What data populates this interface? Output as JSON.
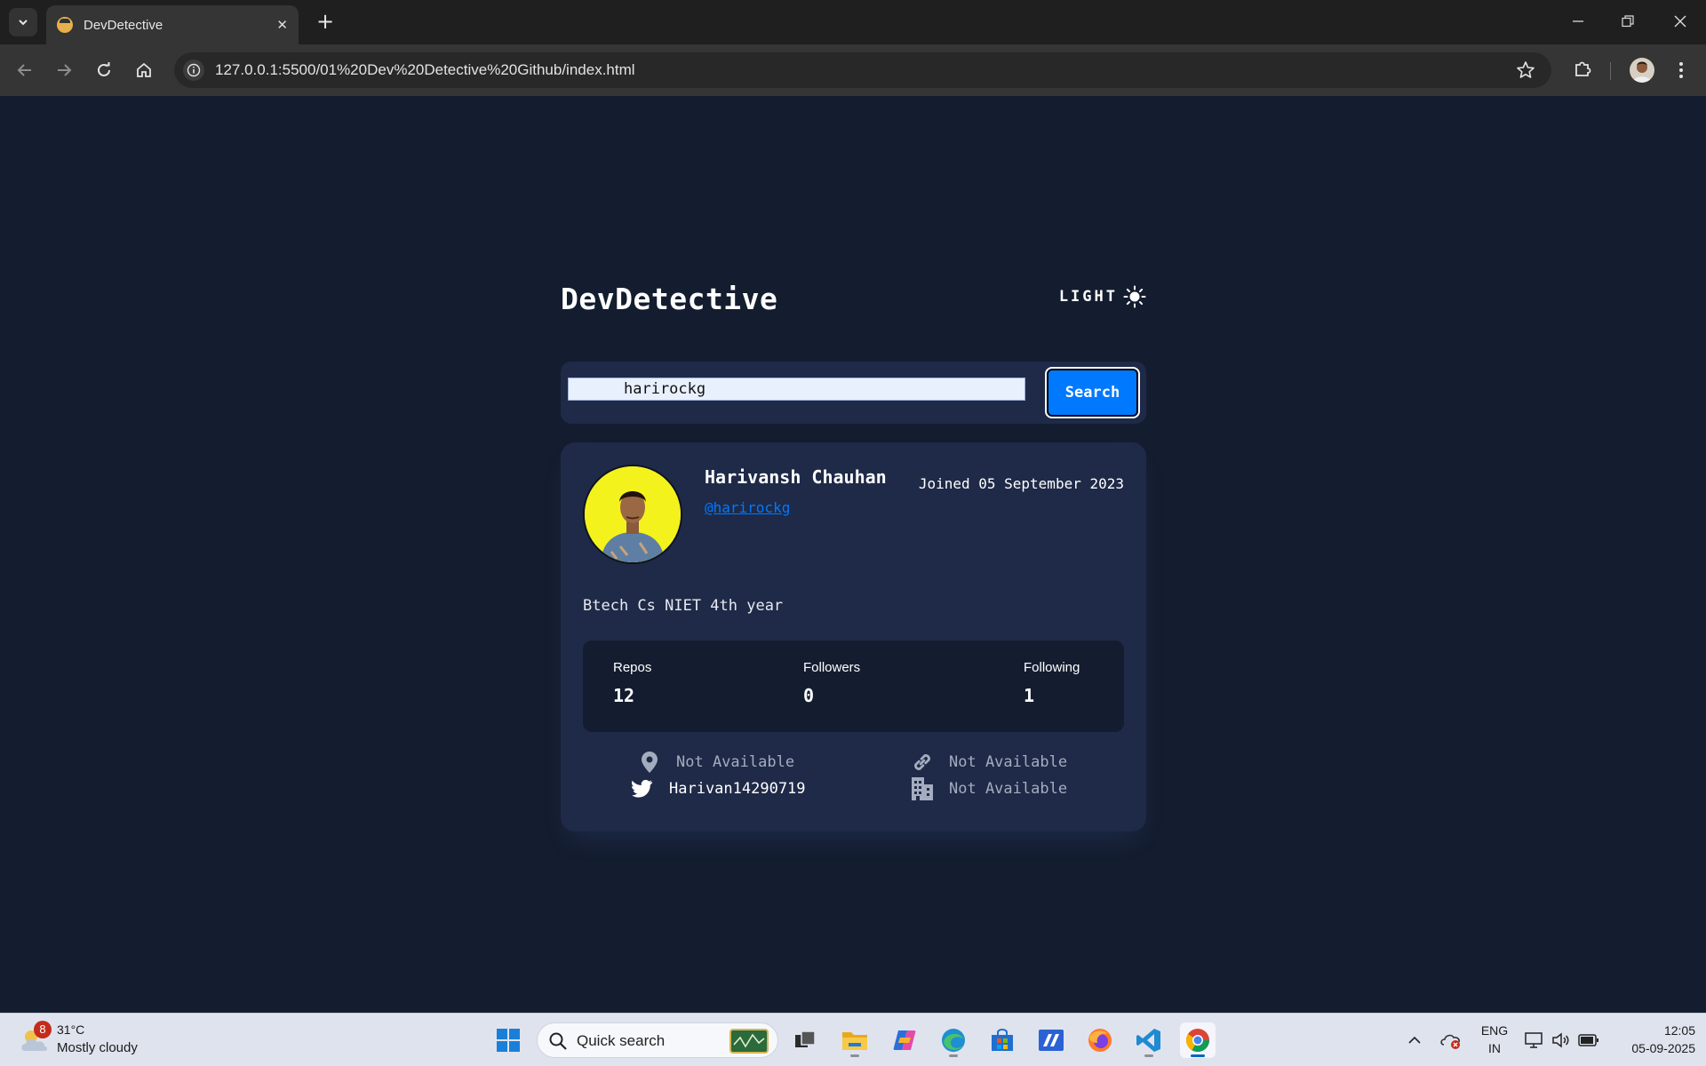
{
  "browser": {
    "tab_title": "DevDetective",
    "url": "127.0.0.1:5500/01%20Dev%20Detective%20Github/index.html"
  },
  "app": {
    "title": "DevDetective",
    "theme_label": "LIGHT",
    "search": {
      "value": "harirockg",
      "button_label": "Search"
    },
    "profile": {
      "name": "Harivansh Chauhan",
      "handle": "@harirockg",
      "joined": "Joined 05 September 2023",
      "bio": "Btech Cs NIET 4th year",
      "stats": [
        {
          "label": "Repos",
          "value": "12"
        },
        {
          "label": "Followers",
          "value": "0"
        },
        {
          "label": "Following",
          "value": "1"
        }
      ],
      "links": {
        "location": "Not Available",
        "website": "Not Available",
        "twitter": "Harivan14290719",
        "company": "Not Available"
      }
    }
  },
  "taskbar": {
    "weather_alert_count": "8",
    "weather_temp": "31°C",
    "weather_desc": "Mostly cloudy",
    "search_placeholder": "Quick search",
    "language_top": "ENG",
    "language_bottom": "IN",
    "time": "12:05",
    "date": "05-09-2025"
  },
  "colors": {
    "page_bg": "#141d2f",
    "card_bg": "#1e2a47",
    "accent": "#0079ff",
    "avatar_bg": "#f4f21c"
  }
}
